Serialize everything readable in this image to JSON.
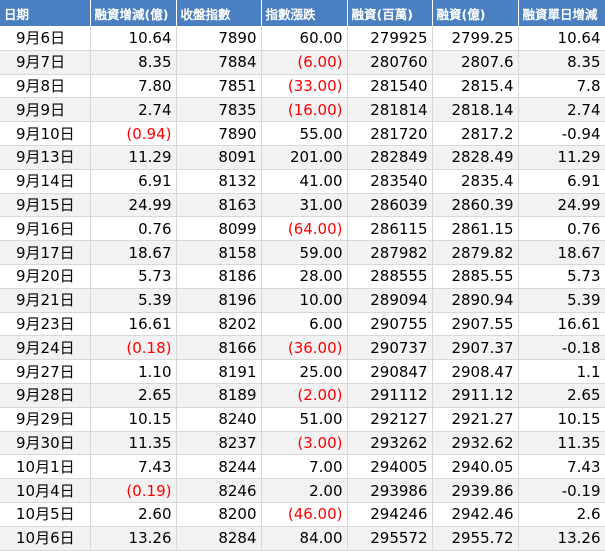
{
  "headers": [
    "日期",
    "融資增減(億)",
    "收盤指數",
    "指數漲跌",
    "融資(百萬)",
    "融資(億)",
    "融資單日增減"
  ],
  "rows": [
    {
      "date": "9月6日",
      "chg": "10.64",
      "close": "7890",
      "idx": "60.00",
      "m": "279925",
      "y": "2799.25",
      "day": "10.64"
    },
    {
      "date": "9月7日",
      "chg": "8.35",
      "close": "7884",
      "idx": "(6.00)",
      "m": "280760",
      "y": "2807.6",
      "day": "8.35"
    },
    {
      "date": "9月8日",
      "chg": "7.80",
      "close": "7851",
      "idx": "(33.00)",
      "m": "281540",
      "y": "2815.4",
      "day": "7.8"
    },
    {
      "date": "9月9日",
      "chg": "2.74",
      "close": "7835",
      "idx": "(16.00)",
      "m": "281814",
      "y": "2818.14",
      "day": "2.74"
    },
    {
      "date": "9月10日",
      "chg": "(0.94)",
      "close": "7890",
      "idx": "55.00",
      "m": "281720",
      "y": "2817.2",
      "day": "-0.94"
    },
    {
      "date": "9月13日",
      "chg": "11.29",
      "close": "8091",
      "idx": "201.00",
      "m": "282849",
      "y": "2828.49",
      "day": "11.29"
    },
    {
      "date": "9月14日",
      "chg": "6.91",
      "close": "8132",
      "idx": "41.00",
      "m": "283540",
      "y": "2835.4",
      "day": "6.91"
    },
    {
      "date": "9月15日",
      "chg": "24.99",
      "close": "8163",
      "idx": "31.00",
      "m": "286039",
      "y": "2860.39",
      "day": "24.99"
    },
    {
      "date": "9月16日",
      "chg": "0.76",
      "close": "8099",
      "idx": "(64.00)",
      "m": "286115",
      "y": "2861.15",
      "day": "0.76"
    },
    {
      "date": "9月17日",
      "chg": "18.67",
      "close": "8158",
      "idx": "59.00",
      "m": "287982",
      "y": "2879.82",
      "day": "18.67"
    },
    {
      "date": "9月20日",
      "chg": "5.73",
      "close": "8186",
      "idx": "28.00",
      "m": "288555",
      "y": "2885.55",
      "day": "5.73"
    },
    {
      "date": "9月21日",
      "chg": "5.39",
      "close": "8196",
      "idx": "10.00",
      "m": "289094",
      "y": "2890.94",
      "day": "5.39"
    },
    {
      "date": "9月23日",
      "chg": "16.61",
      "close": "8202",
      "idx": "6.00",
      "m": "290755",
      "y": "2907.55",
      "day": "16.61"
    },
    {
      "date": "9月24日",
      "chg": "(0.18)",
      "close": "8166",
      "idx": "(36.00)",
      "m": "290737",
      "y": "2907.37",
      "day": "-0.18"
    },
    {
      "date": "9月27日",
      "chg": "1.10",
      "close": "8191",
      "idx": "25.00",
      "m": "290847",
      "y": "2908.47",
      "day": "1.1"
    },
    {
      "date": "9月28日",
      "chg": "2.65",
      "close": "8189",
      "idx": "(2.00)",
      "m": "291112",
      "y": "2911.12",
      "day": "2.65"
    },
    {
      "date": "9月29日",
      "chg": "10.15",
      "close": "8240",
      "idx": "51.00",
      "m": "292127",
      "y": "2921.27",
      "day": "10.15"
    },
    {
      "date": "9月30日",
      "chg": "11.35",
      "close": "8237",
      "idx": "(3.00)",
      "m": "293262",
      "y": "2932.62",
      "day": "11.35"
    },
    {
      "date": "10月1日",
      "chg": "7.43",
      "close": "8244",
      "idx": "7.00",
      "m": "294005",
      "y": "2940.05",
      "day": "7.43"
    },
    {
      "date": "10月4日",
      "chg": "(0.19)",
      "close": "8246",
      "idx": "2.00",
      "m": "293986",
      "y": "2939.86",
      "day": "-0.19"
    },
    {
      "date": "10月5日",
      "chg": "2.60",
      "close": "8200",
      "idx": "(46.00)",
      "m": "294246",
      "y": "2942.46",
      "day": "2.6"
    },
    {
      "date": "10月6日",
      "chg": "13.26",
      "close": "8284",
      "idx": "84.00",
      "m": "295572",
      "y": "2955.72",
      "day": "13.26"
    }
  ],
  "colors": {
    "header_bg": "#4a7fc1",
    "negative": "#ff0000",
    "band": "#f2f2f2"
  }
}
